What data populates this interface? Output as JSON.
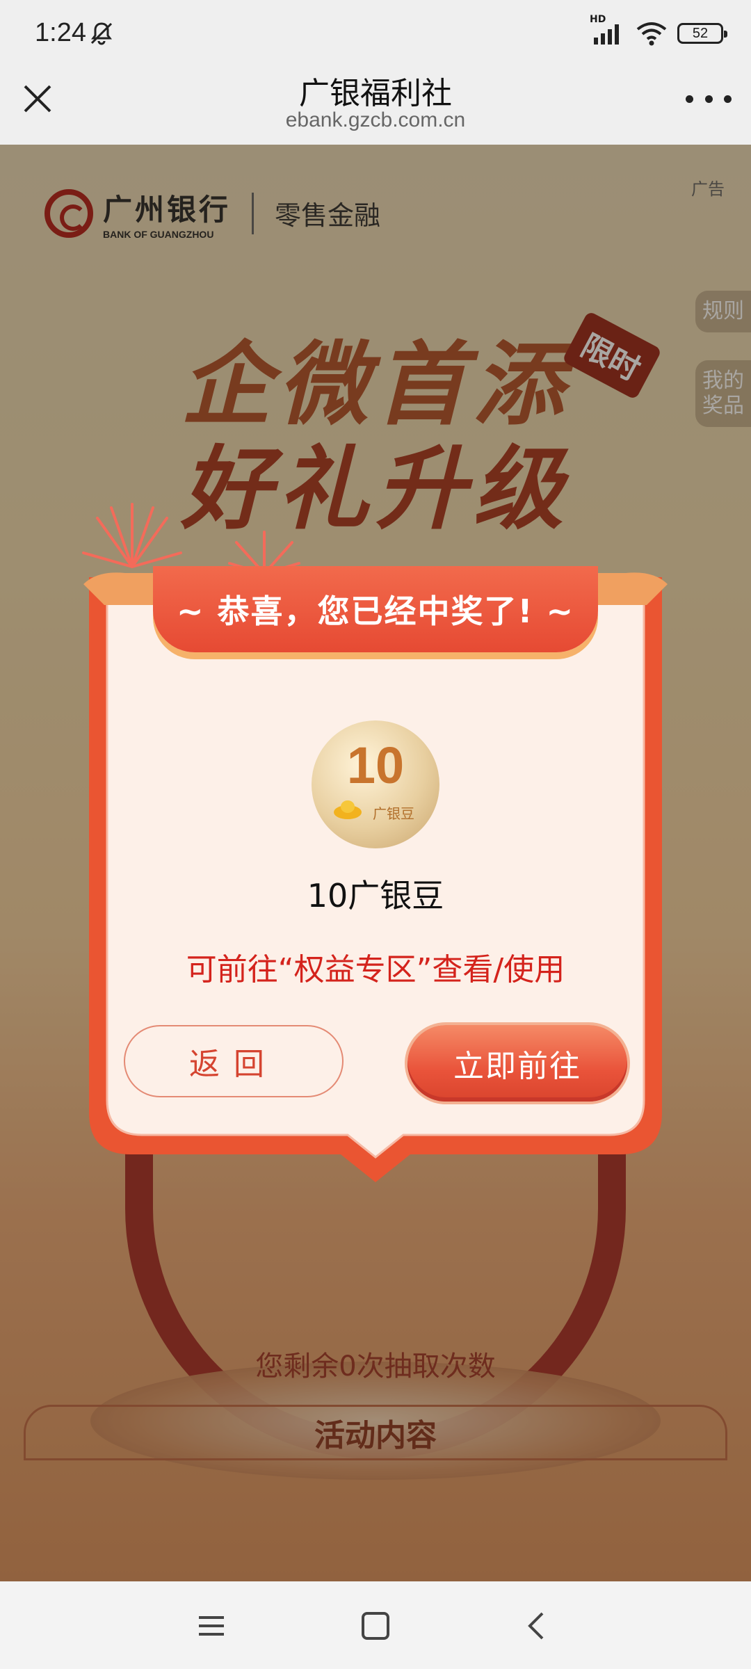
{
  "status_bar": {
    "time": "1:24",
    "hd": "HD",
    "battery": "52"
  },
  "browser": {
    "title": "广银福利社",
    "url": "ebank.gzcb.com.cn"
  },
  "page": {
    "brand_cn": "广州银行",
    "brand_en": "BANK OF GUANGZHOU",
    "brand_sub": "零售金融",
    "ad_label": "广告",
    "side_tabs": [
      "规则",
      "我的奖品"
    ],
    "headline_1": "企微首添",
    "headline_2": "好礼升级",
    "tag_limited": "限时",
    "remaining": "您剩余0次抽取次数",
    "activity_title": "活动内容"
  },
  "modal": {
    "banner": "~ 恭喜，您已经中奖了! ~",
    "coin_value": "10",
    "coin_label": "广银豆",
    "prize_name": "10广银豆",
    "hint": "可前往“权益专区”查看/使用",
    "back_label": "返回",
    "go_label": "立即前往"
  },
  "colors": {
    "accent_red": "#e64a33",
    "hint_red": "#d4231c",
    "modal_bg": "#fdf0e8"
  },
  "icons": {
    "close": "close-icon",
    "more": "more-icon",
    "mute": "mute-icon",
    "signal": "signal-icon",
    "wifi": "wifi-icon",
    "nav_menu": "menu-icon",
    "nav_home": "home-icon",
    "nav_back": "back-icon"
  }
}
